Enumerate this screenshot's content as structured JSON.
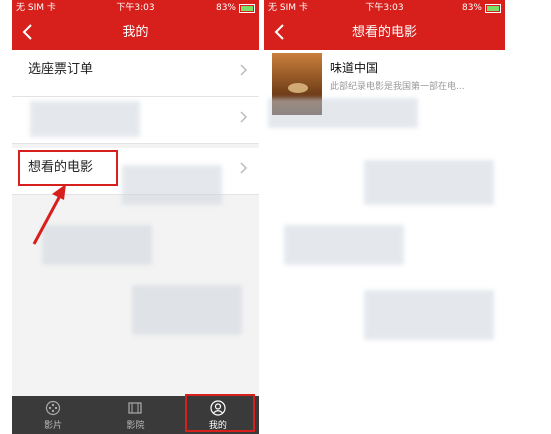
{
  "status": {
    "carrier": "无 SIM 卡",
    "time": "下午3:03",
    "battery": "83%",
    "battery_level": 0.83
  },
  "left_screen": {
    "title": "我的",
    "rows": [
      {
        "label": "选座票订单"
      },
      {
        "label": ""
      },
      {
        "label": "想看的电影"
      }
    ],
    "tabs": [
      {
        "label": "影片",
        "icon": "film-icon"
      },
      {
        "label": "影院",
        "icon": "cinema-icon"
      },
      {
        "label": "我的",
        "icon": "user-icon"
      }
    ]
  },
  "right_screen": {
    "title": "想看的电影",
    "movie": {
      "title": "味道中国",
      "description": "此部纪录电影是我国第一部在电..."
    }
  },
  "colors": {
    "brand_red": "#d7201c",
    "tabbar": "#3a3a3a"
  }
}
